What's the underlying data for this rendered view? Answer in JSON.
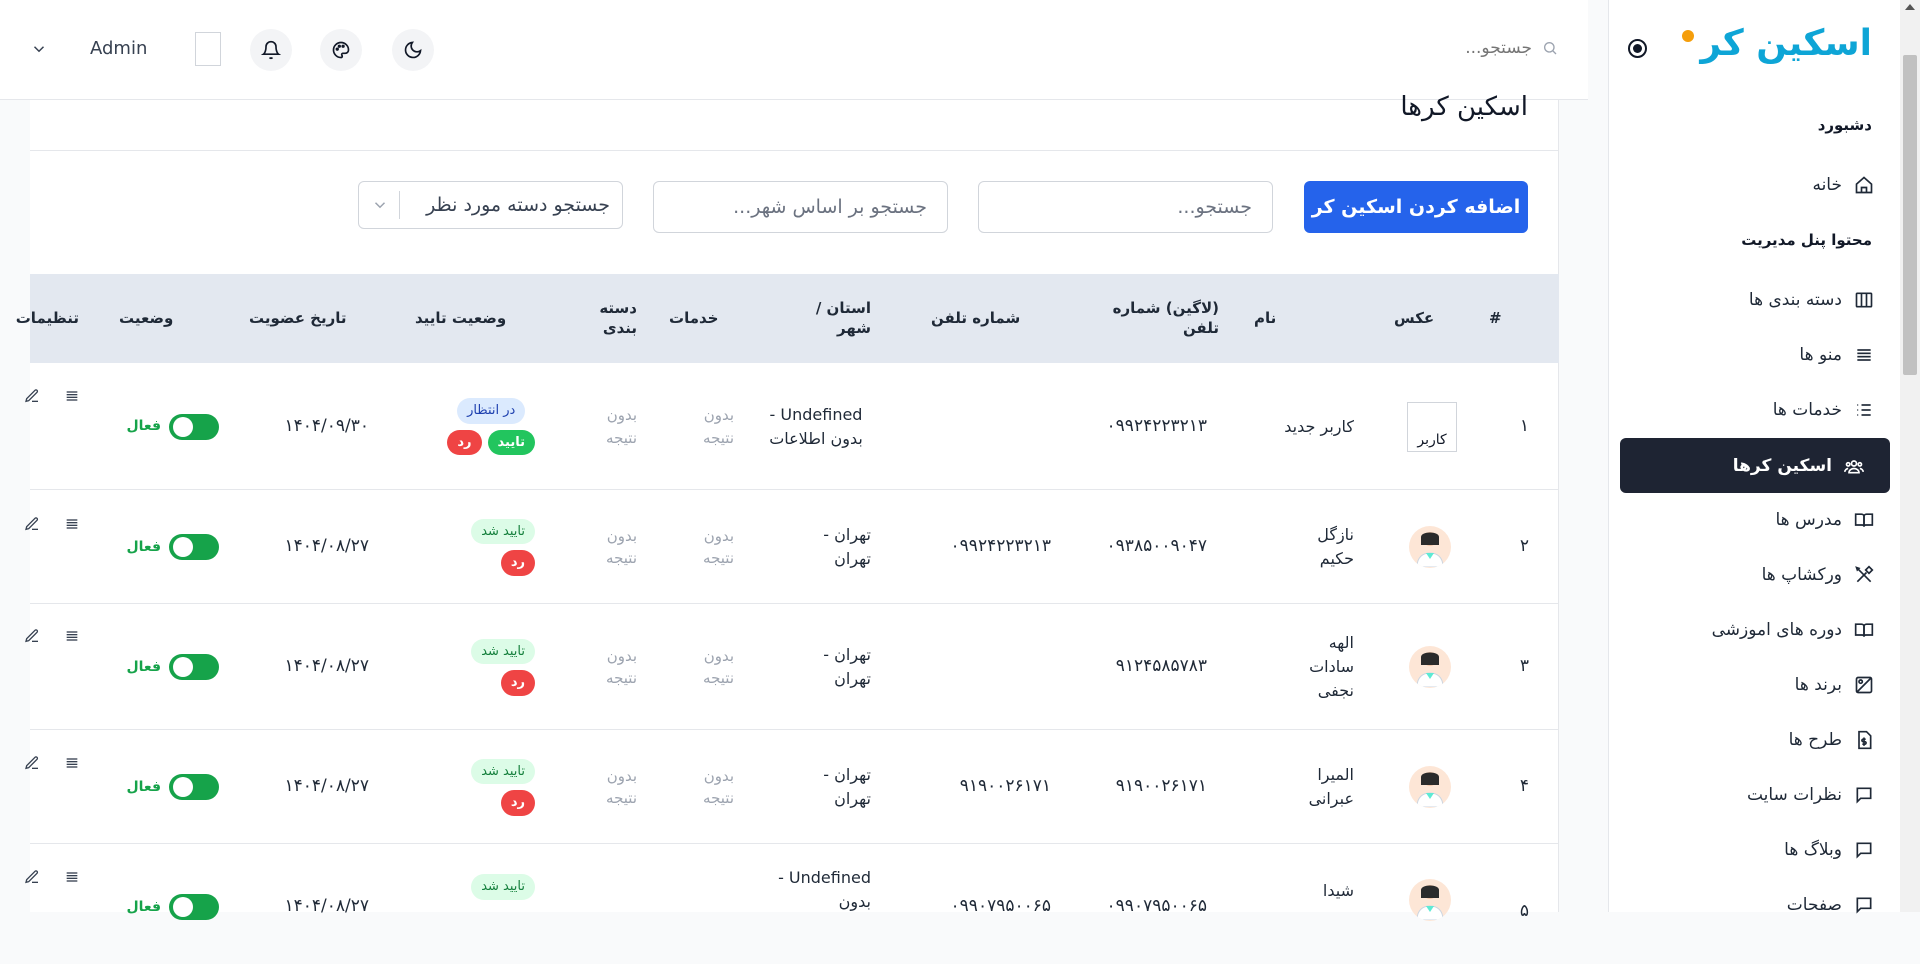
{
  "brand": {
    "name": "اسکین کر"
  },
  "sidebar": {
    "section_dashboard": "دشبورد",
    "section_content": "محتوا پنل مدیریت",
    "items": [
      {
        "label": "خانه",
        "icon": "home-icon"
      },
      {
        "label": "دسته بندی ها",
        "icon": "columns-icon"
      },
      {
        "label": "منو ها",
        "icon": "menu-icon"
      },
      {
        "label": "خدمات ها",
        "icon": "list-icon"
      },
      {
        "label": "اسکین کرها",
        "icon": "users-icon",
        "active": true
      },
      {
        "label": "مدرس ها",
        "icon": "book-icon"
      },
      {
        "label": "ورکشاپ ها",
        "icon": "tools-icon"
      },
      {
        "label": "دوره های اموزشی",
        "icon": "book-open-icon"
      },
      {
        "label": "برند ها",
        "icon": "brand-icon"
      },
      {
        "label": "طرح ها",
        "icon": "file-dollar-icon"
      },
      {
        "label": "نظرات سایت",
        "icon": "chat-icon"
      },
      {
        "label": "وبلاگ ها",
        "icon": "chat-icon"
      },
      {
        "label": "صفحات",
        "icon": "pages-icon"
      }
    ]
  },
  "topbar": {
    "search_placeholder": "جستجو...",
    "user_name": "Admin"
  },
  "main": {
    "title": "اسکین کرها",
    "add_button": "اضافه کردن اسکین کر",
    "search_placeholder": "جستجو...",
    "city_search_placeholder": "جستجو بر اساس شهر...",
    "category_select": "جستجو دسته مورد نظر"
  },
  "table": {
    "headers": {
      "index": "#",
      "photo": "عکس",
      "name": "نام",
      "login_phone": "(لاگین) شماره تلفن",
      "phone": "شماره تلفن",
      "province_city": "استان / شهر",
      "services": "خدمات",
      "category": "دسته بندی",
      "approval_status": "وضعیت تایید",
      "join_date": "تاریخ عضویت",
      "status": "وضعیت",
      "settings": "تنظیمات"
    },
    "labels": {
      "no_result": "بدون نتیجه",
      "active": "فعال",
      "approve": "تایید",
      "reject": "رد",
      "img_alt": "کاربر"
    },
    "rows": [
      {
        "index": "۱",
        "name": "کاربر جدید",
        "login_phone": "۰۹۹۲۴۲۲۳۲۱۳",
        "phone": "",
        "province_city": "Undefined - بدون اطلاعات",
        "approval": "در انتظار",
        "date": "۱۴۰۴/۰۹/۳۰",
        "photo": "broken"
      },
      {
        "index": "۲",
        "name": "نازگل حکیم",
        "login_phone": "۰۹۳۸۵۰۰۹۰۴۷",
        "phone": "۰۹۹۲۴۲۲۳۲۱۳",
        "province_city": "تهران - تهران",
        "approval": "تایید شد",
        "date": "۱۴۰۴/۰۸/۲۷",
        "photo": "avatar"
      },
      {
        "index": "۳",
        "name": "الهه سادات نجفی",
        "login_phone": "۹۱۲۴۵۸۵۷۸۳",
        "phone": "",
        "province_city": "تهران - تهران",
        "approval": "تایید شد",
        "date": "۱۴۰۴/۰۸/۲۷",
        "photo": "avatar"
      },
      {
        "index": "۴",
        "name": "المیرا عبرانی",
        "login_phone": "۹۱۹۰۰۲۶۱۷۱",
        "phone": "۹۱۹۰۰۲۶۱۷۱",
        "province_city": "تهران - تهران",
        "approval": "تایید شد",
        "date": "۱۴۰۴/۰۸/۲۷",
        "photo": "avatar"
      },
      {
        "index": "۵",
        "name": "شیدا",
        "login_phone": "۰۹۹۰۷۹۵۰۰۶۵",
        "phone": "۰۹۹۰۷۹۵۰۰۶۵",
        "province_city": "Undefined - بدون",
        "approval": "تایید شد",
        "date": "۱۴۰۴/۰۸/۲۷",
        "photo": "avatar"
      }
    ]
  },
  "colors": {
    "primary": "#2563eb",
    "sidebar_active": "#1e2433",
    "success": "#16a34a",
    "danger": "#ef4444"
  }
}
